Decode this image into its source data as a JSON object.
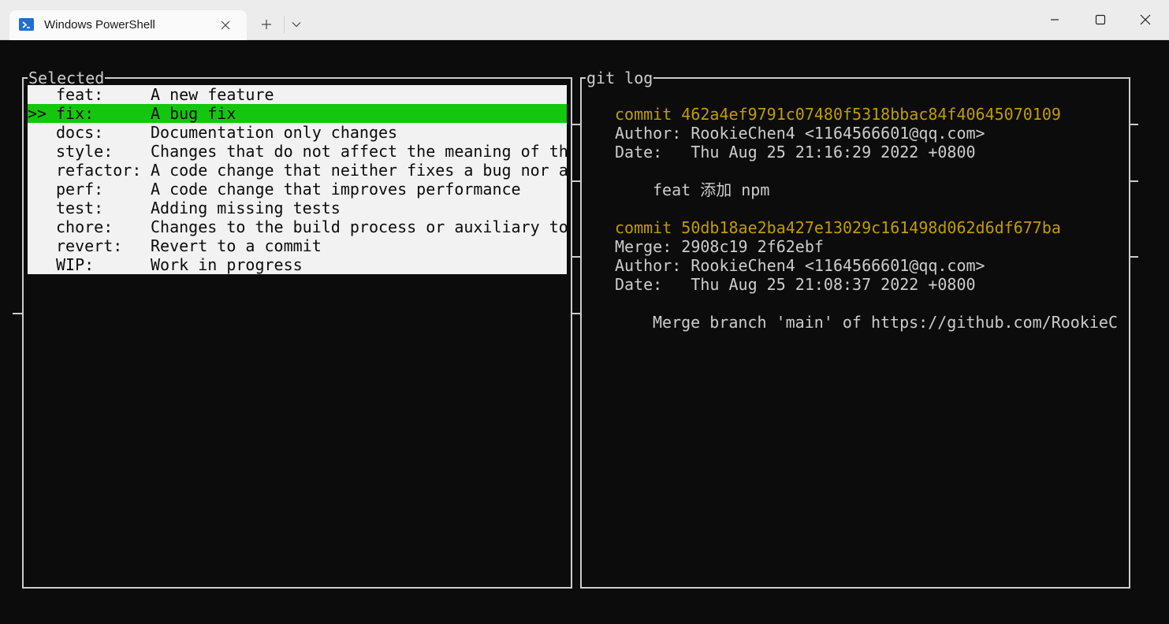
{
  "window": {
    "tab_title": "Windows PowerShell",
    "tab_icon": "powershell-icon",
    "new_tab_icon": "plus-icon",
    "dropdown_icon": "chevron-down-icon",
    "controls": [
      "minimize-icon",
      "maximize-icon",
      "close-icon"
    ]
  },
  "selected_panel": {
    "title": "Selected",
    "items": [
      {
        "marker": "",
        "type": "feat:",
        "desc": "A new feature",
        "selected": false
      },
      {
        "marker": ">>",
        "type": "fix:",
        "desc": "A bug fix",
        "selected": true
      },
      {
        "marker": "",
        "type": "docs:",
        "desc": "Documentation only changes",
        "selected": false
      },
      {
        "marker": "",
        "type": "style:",
        "desc": "Changes that do not affect the meaning of th",
        "selected": false
      },
      {
        "marker": "",
        "type": "refactor:",
        "desc": "A code change that neither fixes a bug nor a",
        "selected": false
      },
      {
        "marker": "",
        "type": "perf:",
        "desc": "A code change that improves performance",
        "selected": false
      },
      {
        "marker": "",
        "type": "test:",
        "desc": "Adding missing tests",
        "selected": false
      },
      {
        "marker": "",
        "type": "chore:",
        "desc": "Changes to the build process or auxiliary to",
        "selected": false
      },
      {
        "marker": "",
        "type": "revert:",
        "desc": "Revert to a commit",
        "selected": false
      },
      {
        "marker": "",
        "type": "WIP:",
        "desc": "Work in progress",
        "selected": false
      }
    ]
  },
  "git_log_panel": {
    "title": "git log",
    "commit1": {
      "commit": "commit 462a4ef9791c07480f5318bbac84f40645070109",
      "author": "Author: RookieChen4 <1164566601@qq.com>",
      "date": "Date:   Thu Aug 25 21:16:29 2022 +0800",
      "message": "feat 添加 npm"
    },
    "commit2": {
      "commit": "commit 50db18ae2ba427e13029c161498d062d6df677ba",
      "merge": "Merge: 2908c19 2f62ebf",
      "author": "Author: RookieChen4 <1164566601@qq.com>",
      "date": "Date:   Thu Aug 25 21:08:37 2022 +0800",
      "message": "Merge branch 'main' of https://github.com/RookieC"
    }
  },
  "colors": {
    "terminal_bg": "#0c0c0c",
    "foreground": "#cccccc",
    "commit_yellow": "#c19c00",
    "selection_green": "#13c70e",
    "list_bg": "#f2f2f2"
  }
}
